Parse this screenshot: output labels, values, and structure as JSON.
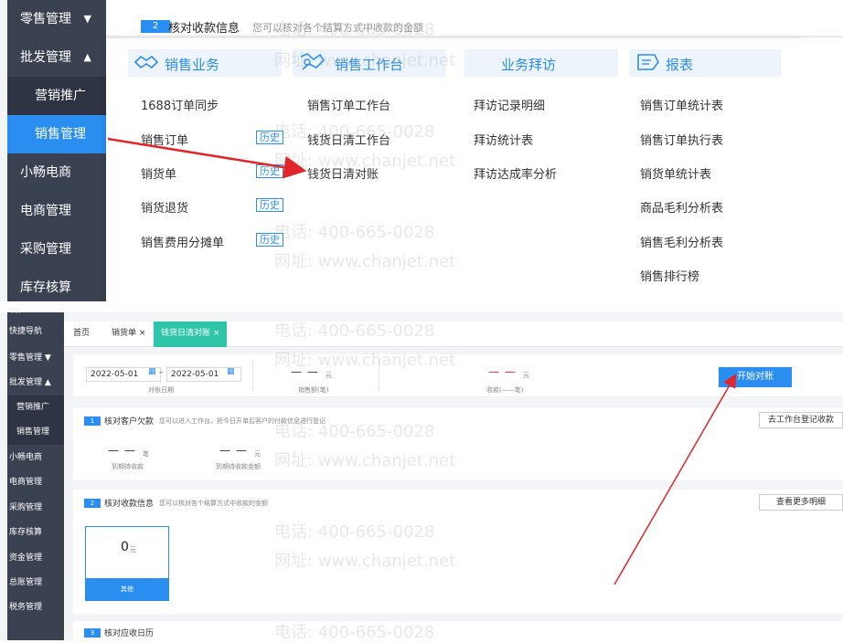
{
  "top": {
    "sidebar": [
      {
        "label": "零售管理",
        "arrow": "▼"
      },
      {
        "label": "批发管理",
        "arrow": "▲"
      },
      {
        "label": "营销推广"
      },
      {
        "label": "销售管理"
      },
      {
        "label": "小畅电商"
      },
      {
        "label": "电商管理"
      },
      {
        "label": "采购管理"
      },
      {
        "label": "库存核算"
      }
    ],
    "strip": {
      "badge": "2",
      "title": "核对收款信息",
      "desc": "您可以核对各个结算方式中收款的金额"
    },
    "columns": [
      {
        "title": "销售业务",
        "icon": "handshake-icon",
        "items": [
          "1688订单同步",
          "销售订单",
          "销货单",
          "销货退货",
          "销售费用分摊单"
        ],
        "history_label": "历史"
      },
      {
        "title": "销售工作台",
        "icon": "workbench-icon",
        "items": [
          "销售订单工作台",
          "钱货日清工作台",
          "钱货日清对账"
        ]
      },
      {
        "title": "业务拜访",
        "items": [
          "拜访记录明细",
          "拜访统计表",
          "拜访达成率分析"
        ]
      },
      {
        "title": "报表",
        "icon": "report-icon",
        "items": [
          "销售订单统计表",
          "销售订单执行表",
          "销货单统计表",
          "商品毛利分析表",
          "销售毛利分析表",
          "销售排行榜"
        ]
      }
    ]
  },
  "bottom": {
    "sidebar": [
      "快捷导航",
      "零售管理 ▼",
      "批发管理 ▲",
      "营销推广",
      "销售管理",
      "小畅电商",
      "电商管理",
      "采购管理",
      "库存核算",
      "资金管理",
      "总账管理",
      "税务管理"
    ],
    "sidebar_top_label": "导航",
    "tabs": [
      "首页",
      "销货单 ×",
      "钱货日清对账 ×"
    ],
    "filter": {
      "date_from": "2022-05-01",
      "date_to": "2022-05-01",
      "date_label": "对账日期",
      "sales_value": "— —",
      "sales_unit": "元",
      "sales_label": "销售额(笔)",
      "receipts_value": "— —",
      "receipts_unit": "元",
      "receipts_label": "收款(——笔)",
      "start_button": "开始对账"
    },
    "section1": {
      "badge": "1",
      "title": "核对客户欠款",
      "desc": "您可以进入工作台，把今日开单后客户的付款信息进行登记",
      "button": "去工作台登记收款",
      "stat1_value": "— —",
      "stat1_unit": "笔",
      "stat1_label": "到期待收款",
      "stat2_value": "— —",
      "stat2_unit": "元",
      "stat2_label": "到期待收款金额"
    },
    "section2": {
      "badge": "2",
      "title": "核对收款信息",
      "desc": "您可以核对各个结算方式中收款的金额",
      "button": "查看更多明细",
      "tile_value": "0",
      "tile_unit": "元",
      "tile_label": "其他"
    },
    "section3": {
      "badge": "3",
      "title": "核对应收日历"
    }
  },
  "watermark": {
    "phone": "电话: 400-665-0028",
    "url": "网址: www.chanjet.net"
  },
  "colors": {
    "accent": "#2a8ef0",
    "sidebar": "#3a4151",
    "active_tab": "#2fc5a9",
    "arrow": "#e0262b"
  }
}
